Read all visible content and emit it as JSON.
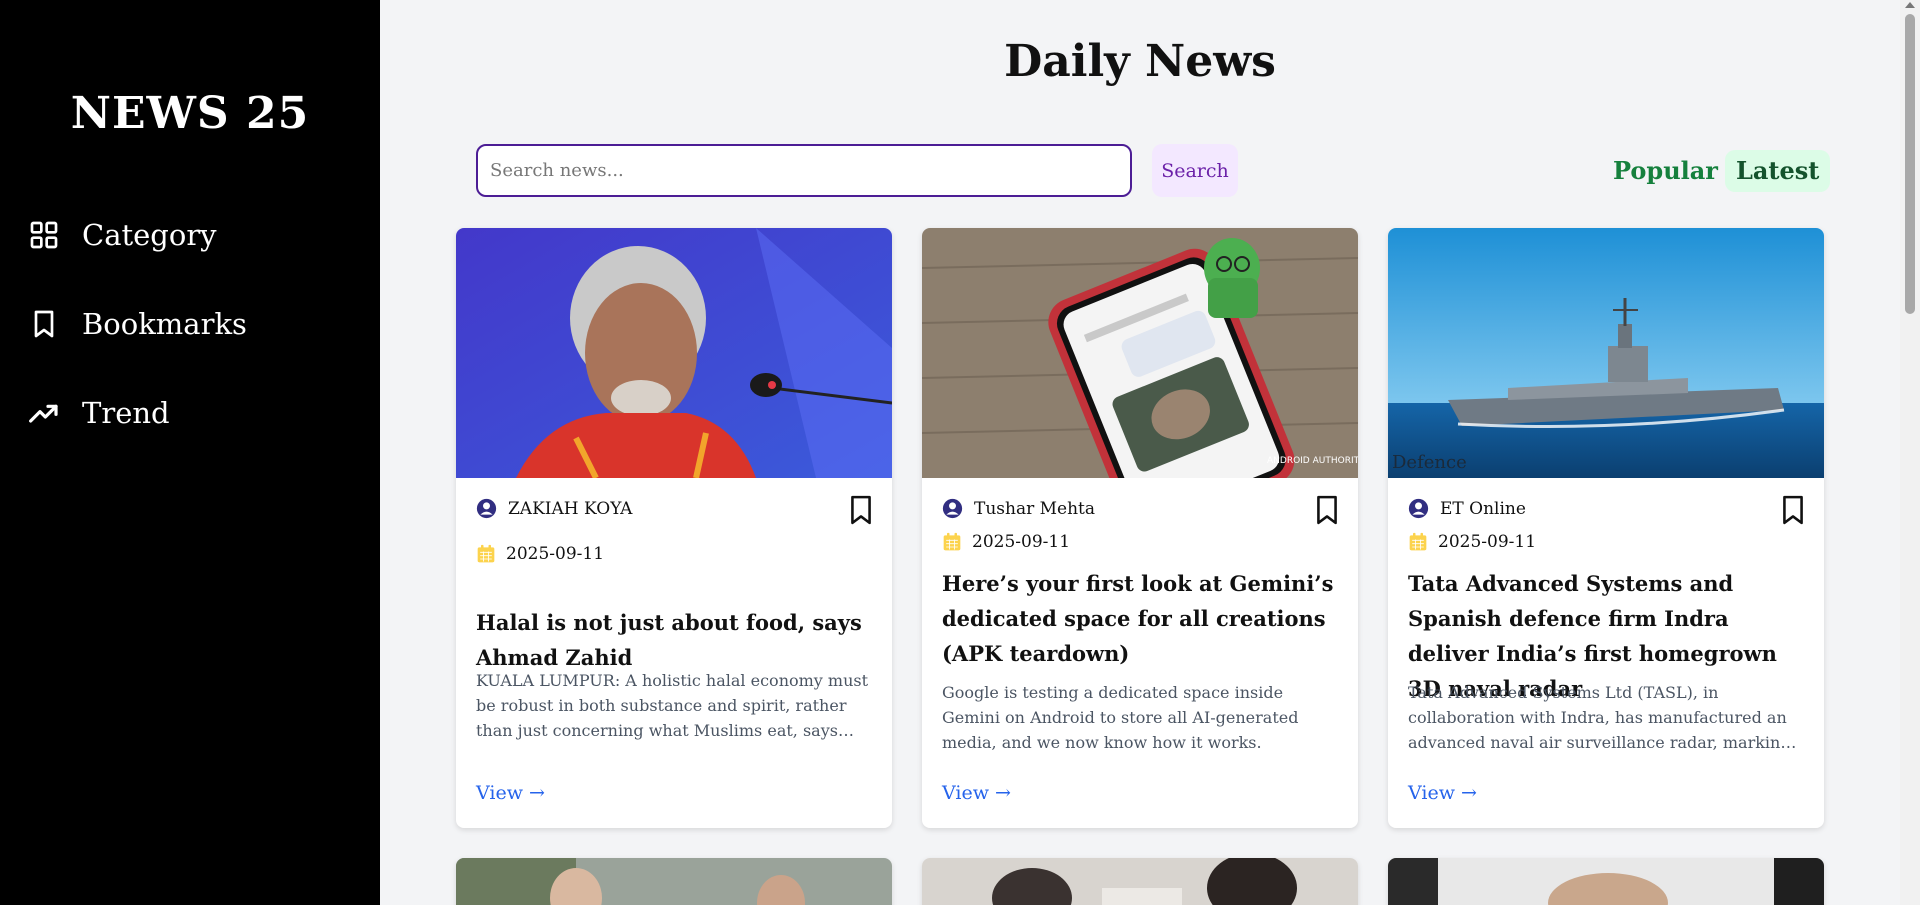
{
  "sidebar": {
    "brand": "NEWS 25",
    "items": [
      {
        "label": "Category",
        "icon": "grid-icon"
      },
      {
        "label": "Bookmarks",
        "icon": "bookmark-icon"
      },
      {
        "label": "Trend",
        "icon": "trending-up-icon"
      }
    ]
  },
  "header": {
    "title": "Daily News"
  },
  "search": {
    "placeholder": "Search news...",
    "value": "",
    "button_label": "Search"
  },
  "filters": {
    "popular_label": "Popular",
    "latest_label": "Latest",
    "active": "Latest"
  },
  "articles": [
    {
      "author": "ZAKIAH KOYA",
      "date": "2025-09-11",
      "title": "Halal is not just about food, says Ahmad Zahid",
      "description": "KUALA LUMPUR: A holistic halal economy must be robust in both substance and spirit, rather than just concerning what Muslims eat, says Deputy Prime Minister Datuk Seri Dr Ahmad Zahid Hamidi.",
      "link_label": "View →",
      "image": "speaker-at-microphone"
    },
    {
      "author": "Tushar Mehta",
      "date": "2025-09-11",
      "title": "Here’s your first look at Gemini’s dedicated space for all creations (APK teardown)",
      "description": "Google is testing a dedicated space inside Gemini on Android to store all AI-generated media, and we now know how it works.",
      "link_label": "View →",
      "image": "phone-on-wooden-table",
      "image_watermark": "ANDROID AUTHORITY"
    },
    {
      "author": "ET Online",
      "date": "2025-09-11",
      "title": "Tata Advanced Systems and Spanish defence firm Indra deliver India’s first homegrown 3D naval radar",
      "description": "Tata Advanced Systems Ltd (TASL), in collaboration with Indra, has manufactured an advanced naval air surveillance radar, marking a significant milestone in India’s defence manufacturing.",
      "link_label": "View →",
      "image": "naval-ship-at-sea",
      "image_watermark": "Defence"
    }
  ],
  "colors": {
    "sidebar_bg": "#000000",
    "page_bg": "#f3f4f6",
    "search_border": "#4c1d95",
    "search_button_bg": "#f3e8ff",
    "filter_green": "#15803d",
    "filter_active_bg": "#dcfce7",
    "link_blue": "#2563eb",
    "date_icon": "#fcd34d",
    "author_icon": "#312e81"
  }
}
